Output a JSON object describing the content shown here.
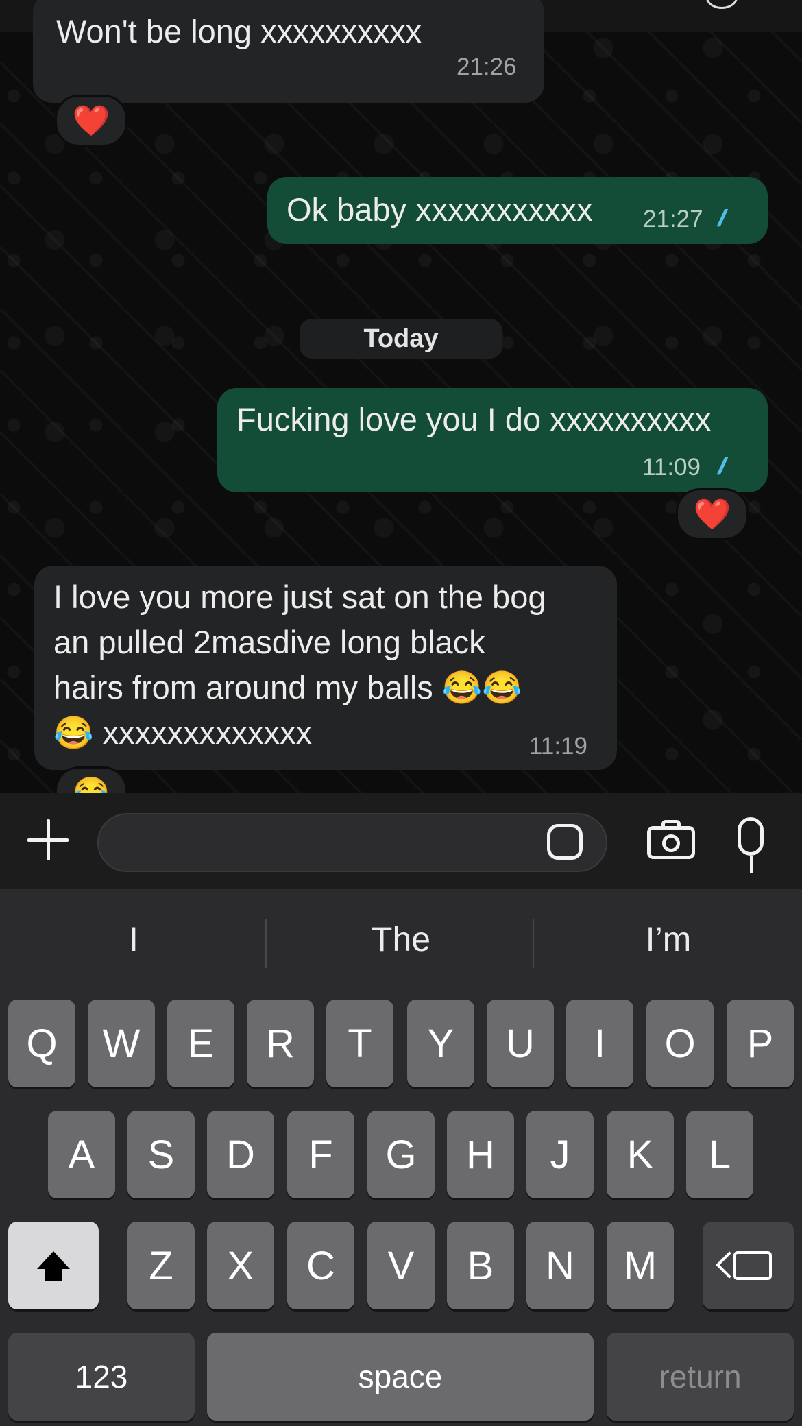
{
  "messages": [
    {
      "dir": "in",
      "text": "Won't be long xxxxxxxxxx",
      "time": "21:26",
      "reaction": "❤️"
    },
    {
      "dir": "out",
      "text": "Ok baby xxxxxxxxxxx",
      "time": "21:27",
      "ticks": "//"
    },
    {
      "dir": "out",
      "text": "Fucking love you I do xxxxxxxxxx",
      "time": "11:09",
      "ticks": "//",
      "reaction": "❤️"
    },
    {
      "dir": "in",
      "lines": [
        "I love you more just sat on the bog",
        "an pulled 2masdive long black",
        "hairs from around my balls 😂😂",
        "😂 xxxxxxxxxxxxx"
      ],
      "time": "11:19",
      "reaction": "😂"
    }
  ],
  "day_separator": "Today",
  "suggestions": [
    "I",
    "The",
    "I’m"
  ],
  "keys": {
    "row1": [
      "Q",
      "W",
      "E",
      "R",
      "T",
      "Y",
      "U",
      "I",
      "O",
      "P"
    ],
    "row2": [
      "A",
      "S",
      "D",
      "F",
      "G",
      "H",
      "J",
      "K",
      "L"
    ],
    "row3": [
      "Z",
      "X",
      "C",
      "V",
      "B",
      "N",
      "M"
    ],
    "numbers": "123",
    "space": "space",
    "return": "return"
  },
  "colors": {
    "incoming_bubble": "#232426",
    "outgoing_bubble": "#134d37",
    "read_ticks": "#53bdeb"
  }
}
